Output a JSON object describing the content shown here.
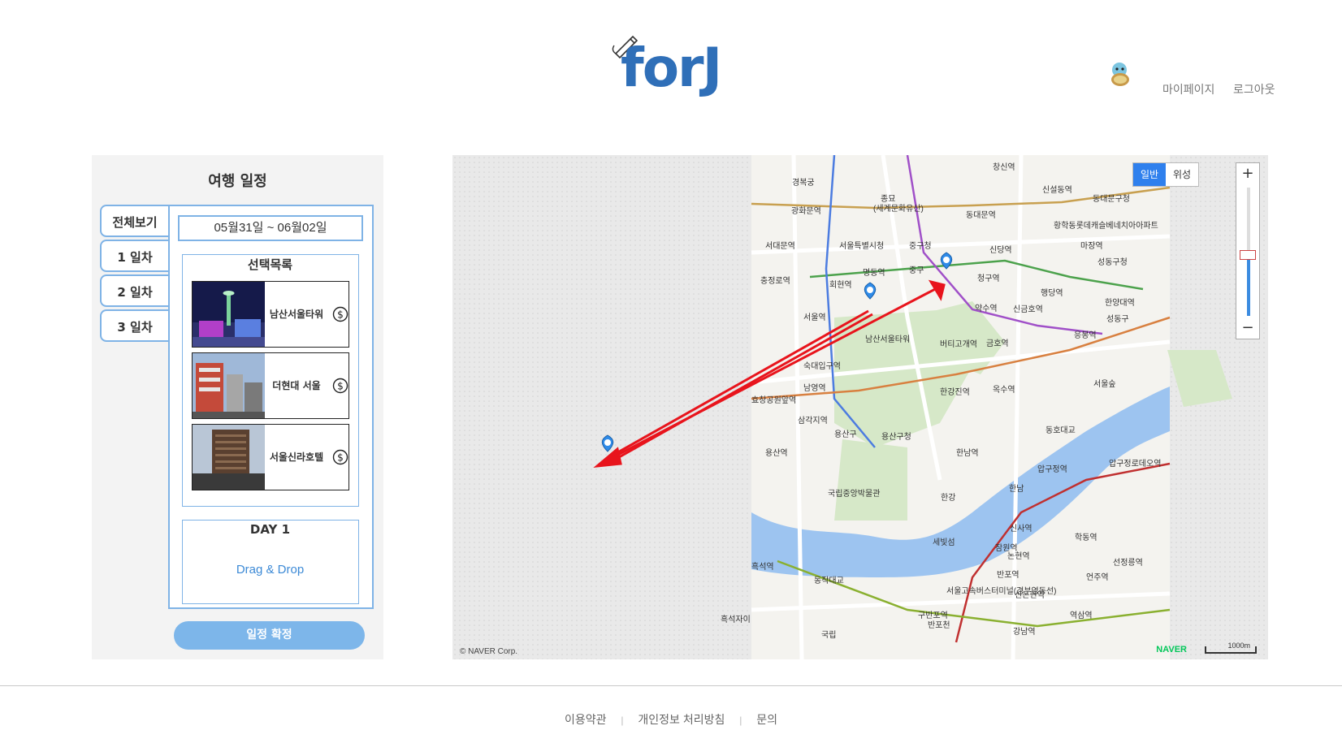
{
  "header": {
    "logo_text": "forJ",
    "mypage_label": "마이페이지",
    "logout_label": "로그아웃"
  },
  "schedule": {
    "title": "여행 일정",
    "tabs": [
      {
        "label": "전체보기"
      },
      {
        "label": "1 일차"
      },
      {
        "label": "2 일차"
      },
      {
        "label": "3 일차"
      }
    ],
    "date_range": "05월31일 ~ 06월02일",
    "selection_title": "선택목록",
    "places": [
      {
        "name": "남산서울타워",
        "icon": "dollar-icon"
      },
      {
        "name": "더현대 서울",
        "icon": "dollar-icon"
      },
      {
        "name": "서울신라호텔",
        "icon": "dollar-icon"
      }
    ],
    "day_title": "DAY 1",
    "drop_hint": "Drag & Drop",
    "confirm_label": "일정 확정"
  },
  "map": {
    "type_buttons": [
      "일반",
      "위성"
    ],
    "active_type": "일반",
    "zoom_in": "+",
    "zoom_out": "−",
    "copyright": "© NAVER Corp.",
    "brand": "NAVER",
    "scale_label": "1000m",
    "labels": [
      "경복궁",
      "종묘",
      "(세계문화유산)",
      "동대문역",
      "신설동역",
      "동대문구청",
      "창신역",
      "광화문역",
      "서대문역",
      "서울특별시청",
      "중구청",
      "중구",
      "신당역",
      "황학동롯데캐슬베네치아아파트",
      "마장역",
      "성동구청",
      "충정로역",
      "명동역",
      "회현역",
      "청구역",
      "행당역",
      "서울역",
      "남산서울타워",
      "약수역",
      "신금호역",
      "버티고개역",
      "금호역",
      "한양대역",
      "성동구",
      "응봉역",
      "숙대입구역",
      "남영역",
      "한강진역",
      "옥수역",
      "서울숲",
      "효창공원앞역",
      "삼각지역",
      "용산구",
      "용산구청",
      "동호대교",
      "용산역",
      "한남역",
      "압구정역",
      "압구정로데오역",
      "국립중앙박물관",
      "한강",
      "한남",
      "신사역",
      "학동역",
      "흑석역",
      "세빛섬",
      "잠원역",
      "논현역",
      "선정릉역",
      "반포역",
      "동작대교",
      "서울고속버스터미널(경부영동선)",
      "신논현역",
      "언주역",
      "구반포역",
      "반포천",
      "역삼역",
      "흑석자이",
      "강남역",
      "국립"
    ],
    "accent": "#2f80ed",
    "route_color": "#e8141c"
  },
  "footer": {
    "terms": "이용약관",
    "privacy": "개인정보 처리방침",
    "contact": "문의"
  }
}
